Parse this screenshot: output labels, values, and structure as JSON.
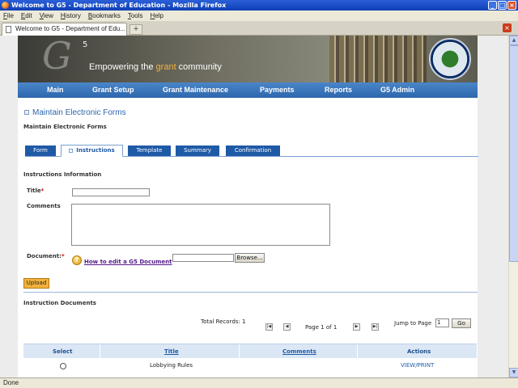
{
  "window": {
    "title": "Welcome to G5 - Department of Education - Mozilla Firefox"
  },
  "menubar": [
    "File",
    "Edit",
    "View",
    "History",
    "Bookmarks",
    "Tools",
    "Help"
  ],
  "browser_tab": {
    "label": "Welcome to G5 - Department of Edu...",
    "new_tab": "+"
  },
  "banner": {
    "logo": "G",
    "logo_sup": "5",
    "tagline_pre": "Empowering the ",
    "tagline_accent": "grant",
    "tagline_post": " community"
  },
  "nav": [
    "Main",
    "Grant Setup",
    "Grant Maintenance",
    "Payments",
    "Reports",
    "G5 Admin"
  ],
  "page": {
    "heading": "Maintain Electronic Forms",
    "subheading": "Maintain Electronic Forms"
  },
  "tabs": [
    "Form",
    "Instructions",
    "Template",
    "Summary",
    "Confirmation"
  ],
  "form": {
    "section_title": "Instructions Information",
    "title_label": "Title",
    "title_value": "",
    "comments_label": "Comments",
    "comments_value": "",
    "document_label": "Document:",
    "required_mark": "*",
    "help_link": "How to edit a G5 Document",
    "browse_label": "Browse...",
    "upload_label": "Upload"
  },
  "documents": {
    "section_title": "Instruction Documents",
    "total_records": "Total Records: 1",
    "page_info": "Page 1 of 1",
    "jump_label": "Jump to Page",
    "jump_value": "1",
    "go_label": "Go",
    "columns": [
      "Select",
      "Title",
      "Comments",
      "Actions"
    ],
    "rows": [
      {
        "title": "Lobbying Rules",
        "comments": "",
        "action": "VIEW/PRINT"
      }
    ]
  },
  "status": "Done",
  "colors": {
    "nav_blue": "#2d66ad",
    "tab_blue": "#1f5aa6",
    "accent_orange": "#f3b23c",
    "required_red": "#cc0000"
  }
}
